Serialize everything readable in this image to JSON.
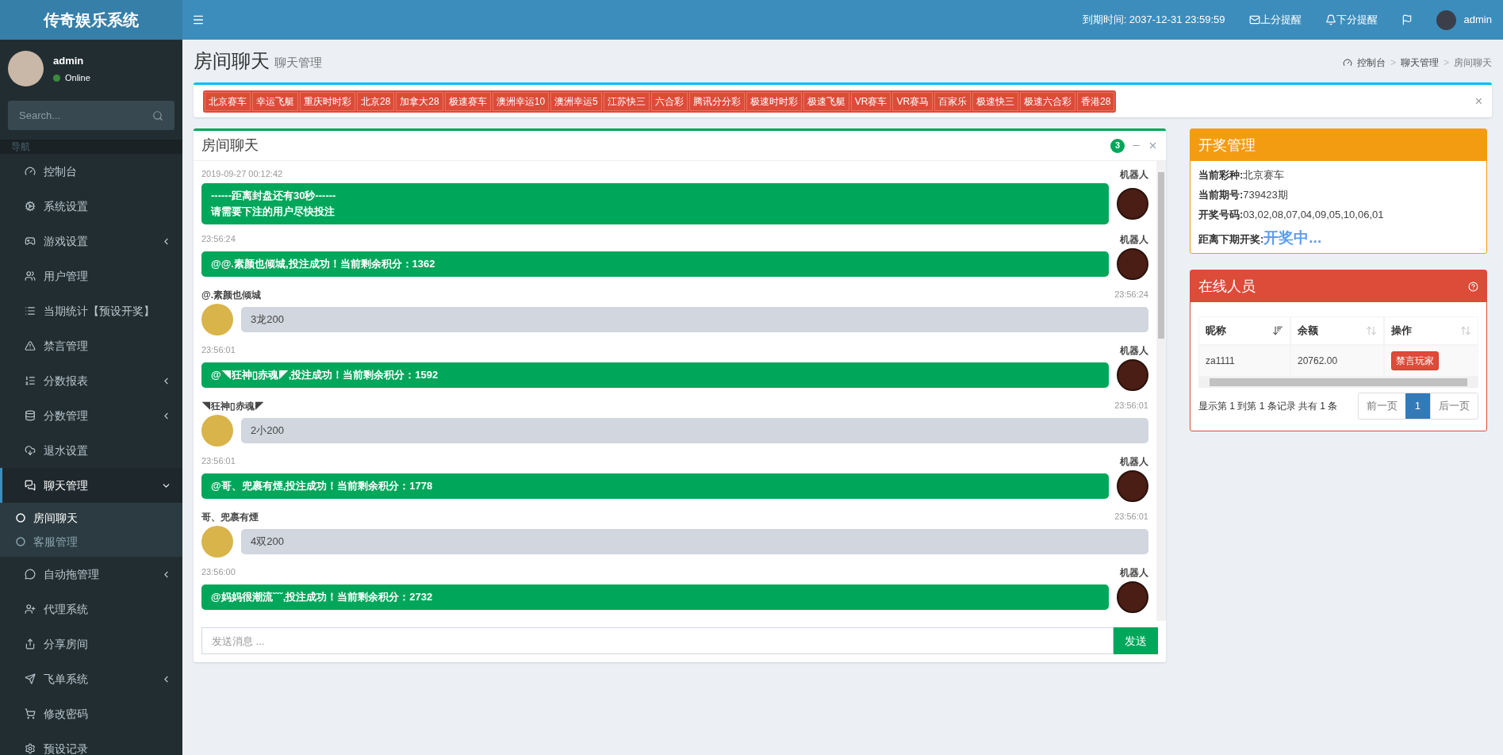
{
  "header": {
    "logo": "传奇娱乐系统",
    "expiry": "到期时间: 2037-12-31 23:59:59",
    "alerts": [
      {
        "kind": "mail",
        "label": "上分提醒"
      },
      {
        "kind": "bell",
        "label": "下分提醒"
      }
    ],
    "user": "admin"
  },
  "sidebar": {
    "user": "admin",
    "status": "Online",
    "search_placeholder": "Search...",
    "section": "导航",
    "items": [
      {
        "label": "控制台",
        "kind": "link",
        "selected": false
      },
      {
        "label": "系统设置",
        "kind": "link",
        "selected": false
      },
      {
        "label": "游戏设置",
        "kind": "menu",
        "expanded": false,
        "selected": false
      },
      {
        "label": "用户管理",
        "kind": "link",
        "selected": false
      },
      {
        "label": "当期统计【预设开奖】",
        "kind": "link",
        "selected": false
      },
      {
        "label": "禁言管理",
        "kind": "link",
        "selected": false
      },
      {
        "label": "分数报表",
        "kind": "menu",
        "expanded": false,
        "selected": false
      },
      {
        "label": "分数管理",
        "kind": "menu",
        "expanded": false,
        "selected": false
      },
      {
        "label": "退水设置",
        "kind": "link",
        "selected": false
      },
      {
        "label": "聊天管理",
        "kind": "menu",
        "expanded": true,
        "selected": true,
        "children": [
          {
            "label": "房间聊天",
            "selected": true
          },
          {
            "label": "客服管理",
            "selected": false
          }
        ]
      },
      {
        "label": "自动拖管理",
        "kind": "menu",
        "expanded": false,
        "selected": false
      },
      {
        "label": "代理系统",
        "kind": "link",
        "selected": false
      },
      {
        "label": "分享房间",
        "kind": "link",
        "selected": false
      },
      {
        "label": "飞单系统",
        "kind": "menu",
        "expanded": false,
        "selected": false
      },
      {
        "label": "修改密码",
        "kind": "link",
        "selected": false
      },
      {
        "label": "预设记录",
        "kind": "link",
        "selected": false
      }
    ]
  },
  "page": {
    "title": "房间聊天",
    "subtitle": "聊天管理",
    "breadcrumb": [
      "控制台",
      "聊天管理",
      "房间聊天"
    ],
    "breadcrumb_separator": ">"
  },
  "lottery_tags": {
    "tags": [
      "北京赛车",
      "幸运飞艇",
      "重庆时时彩",
      "北京28",
      "加拿大28",
      "极速赛车",
      "澳洲幸运10",
      "澳洲幸运5",
      "江苏快三",
      "六合彩",
      "腾讯分分彩",
      "极速时时彩",
      "极速飞艇",
      "VR赛车",
      "VR赛马",
      "百家乐",
      "极速快三",
      "极速六合彩",
      "香港28"
    ],
    "close": "×"
  },
  "chat": {
    "title": "房间聊天",
    "badge": "3",
    "messages": [
      {
        "kind": "robot",
        "sender": "机器人",
        "time": "2019-09-27 00:12:42",
        "lines": [
          "------距离封盘还有30秒------",
          "请需要下注的用户尽快投注"
        ]
      },
      {
        "kind": "robot",
        "sender": "机器人",
        "time": "23:56:24",
        "lines": [
          "@@.素颜也倾城,投注成功！当前剩余积分：1362"
        ]
      },
      {
        "kind": "user",
        "sender": "@.素颜也倾城",
        "time": "23:56:24",
        "lines": [
          "3龙200"
        ]
      },
      {
        "kind": "robot",
        "sender": "机器人",
        "time": "23:56:01",
        "lines": [
          "@◥狂神▯赤魂◤,投注成功！当前剩余积分：1592"
        ]
      },
      {
        "kind": "user",
        "sender": "◥狂神▯赤魂◤",
        "time": "23:56:01",
        "lines": [
          "2小200"
        ]
      },
      {
        "kind": "robot",
        "sender": "机器人",
        "time": "23:56:01",
        "lines": [
          "@哥、兜裹有煙,投注成功！当前剩余积分：1778"
        ]
      },
      {
        "kind": "user",
        "sender": "哥、兜裹有煙",
        "time": "23:56:01",
        "lines": [
          "4双200"
        ]
      },
      {
        "kind": "robot",
        "sender": "机器人",
        "time": "23:56:00",
        "lines": [
          "@妈妈很潮流ˇˇˇ,投注成功！当前剩余积分：2732"
        ]
      }
    ],
    "input_placeholder": "发送消息 ...",
    "send": "发送"
  },
  "draw_panel": {
    "title": "开奖管理",
    "rows": [
      {
        "label": "当前彩种:",
        "value": "北京赛车",
        "kind": "plain"
      },
      {
        "label": "当前期号:",
        "value": "739423期",
        "kind": "plain"
      },
      {
        "label": "开奖号码:",
        "value": "03,02,08,07,04,09,05,10,06,01",
        "kind": "plain"
      },
      {
        "label": "距离下期开奖:",
        "value": "开奖中...",
        "kind": "highlight"
      }
    ]
  },
  "online_panel": {
    "title": "在线人员",
    "columns": [
      {
        "label": "昵称",
        "sorted": true
      },
      {
        "label": "余额",
        "sorted": false
      },
      {
        "label": "操作",
        "sorted": false
      }
    ],
    "rows": [
      {
        "nickname": "za1111",
        "balance": "20762.00",
        "action": "禁言玩家"
      }
    ],
    "info": "显示第 1 到第 1 条记录 共有 1 条",
    "prev": "前一页",
    "pages": [
      {
        "label": "1",
        "selected": true
      }
    ],
    "next": "后一页"
  }
}
